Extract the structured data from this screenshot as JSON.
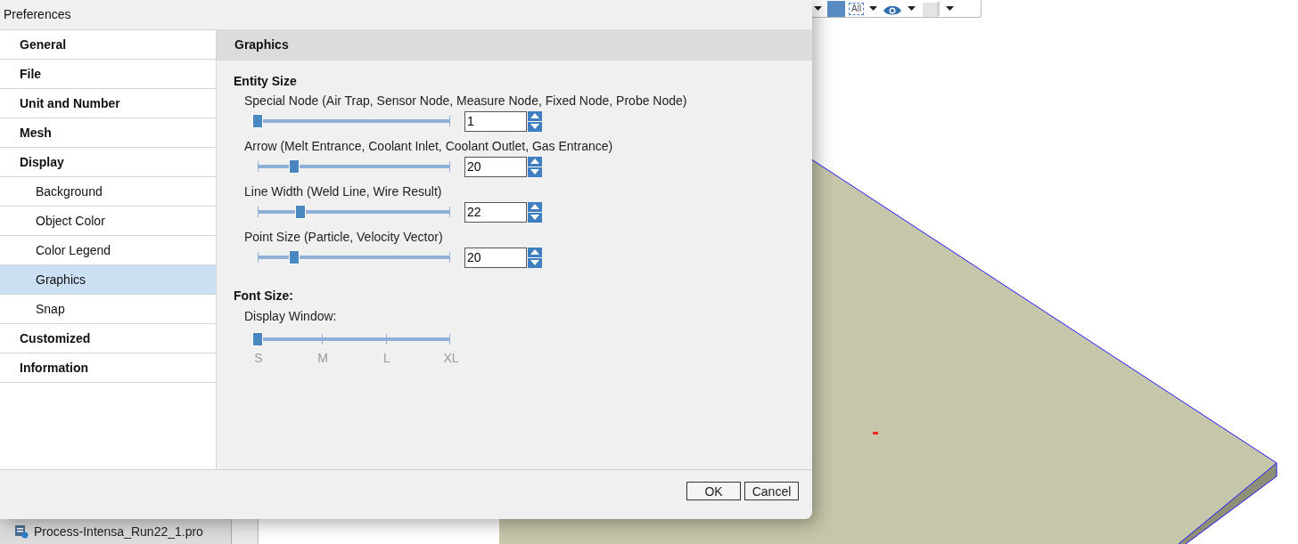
{
  "toolbar": {
    "all_label": "All"
  },
  "dialog": {
    "title": "Preferences",
    "sidebar": {
      "items": [
        {
          "label": "General",
          "selected": false
        },
        {
          "label": "File",
          "selected": false
        },
        {
          "label": "Unit and Number",
          "selected": false
        },
        {
          "label": "Mesh",
          "selected": false
        },
        {
          "label": "Display",
          "selected": false,
          "children": [
            {
              "label": "Background",
              "selected": false
            },
            {
              "label": "Object Color",
              "selected": false
            },
            {
              "label": "Color Legend",
              "selected": false
            },
            {
              "label": "Graphics",
              "selected": true
            },
            {
              "label": "Snap",
              "selected": false
            }
          ]
        },
        {
          "label": "Customized",
          "selected": false
        },
        {
          "label": "Information",
          "selected": false
        }
      ]
    },
    "panel": {
      "title": "Graphics",
      "entity_size": {
        "heading": "Entity Size",
        "settings": [
          {
            "label": "Special Node (Air Trap, Sensor Node, Measure Node, Fixed Node, Probe Node)",
            "level": 0,
            "value": "1"
          },
          {
            "label": "Arrow (Melt Entrance, Coolant Inlet, Coolant Outlet, Gas Entrance)",
            "level": 0.19,
            "value": "20"
          },
          {
            "label": "Line Width (Weld Line, Wire Result)",
            "level": 0.22,
            "value": "22"
          },
          {
            "label": "Point Size (Particle, Velocity Vector)",
            "level": 0.19,
            "value": "20"
          }
        ]
      },
      "font_size": {
        "heading": "Font Size:",
        "label": "Display Window:",
        "level": 0,
        "ticks": [
          "S",
          "M",
          "L",
          "XL"
        ]
      }
    },
    "buttons": [
      "OK",
      "Cancel"
    ]
  },
  "file_tab": {
    "label": "Process-Intensa_Run22_1.pro"
  }
}
